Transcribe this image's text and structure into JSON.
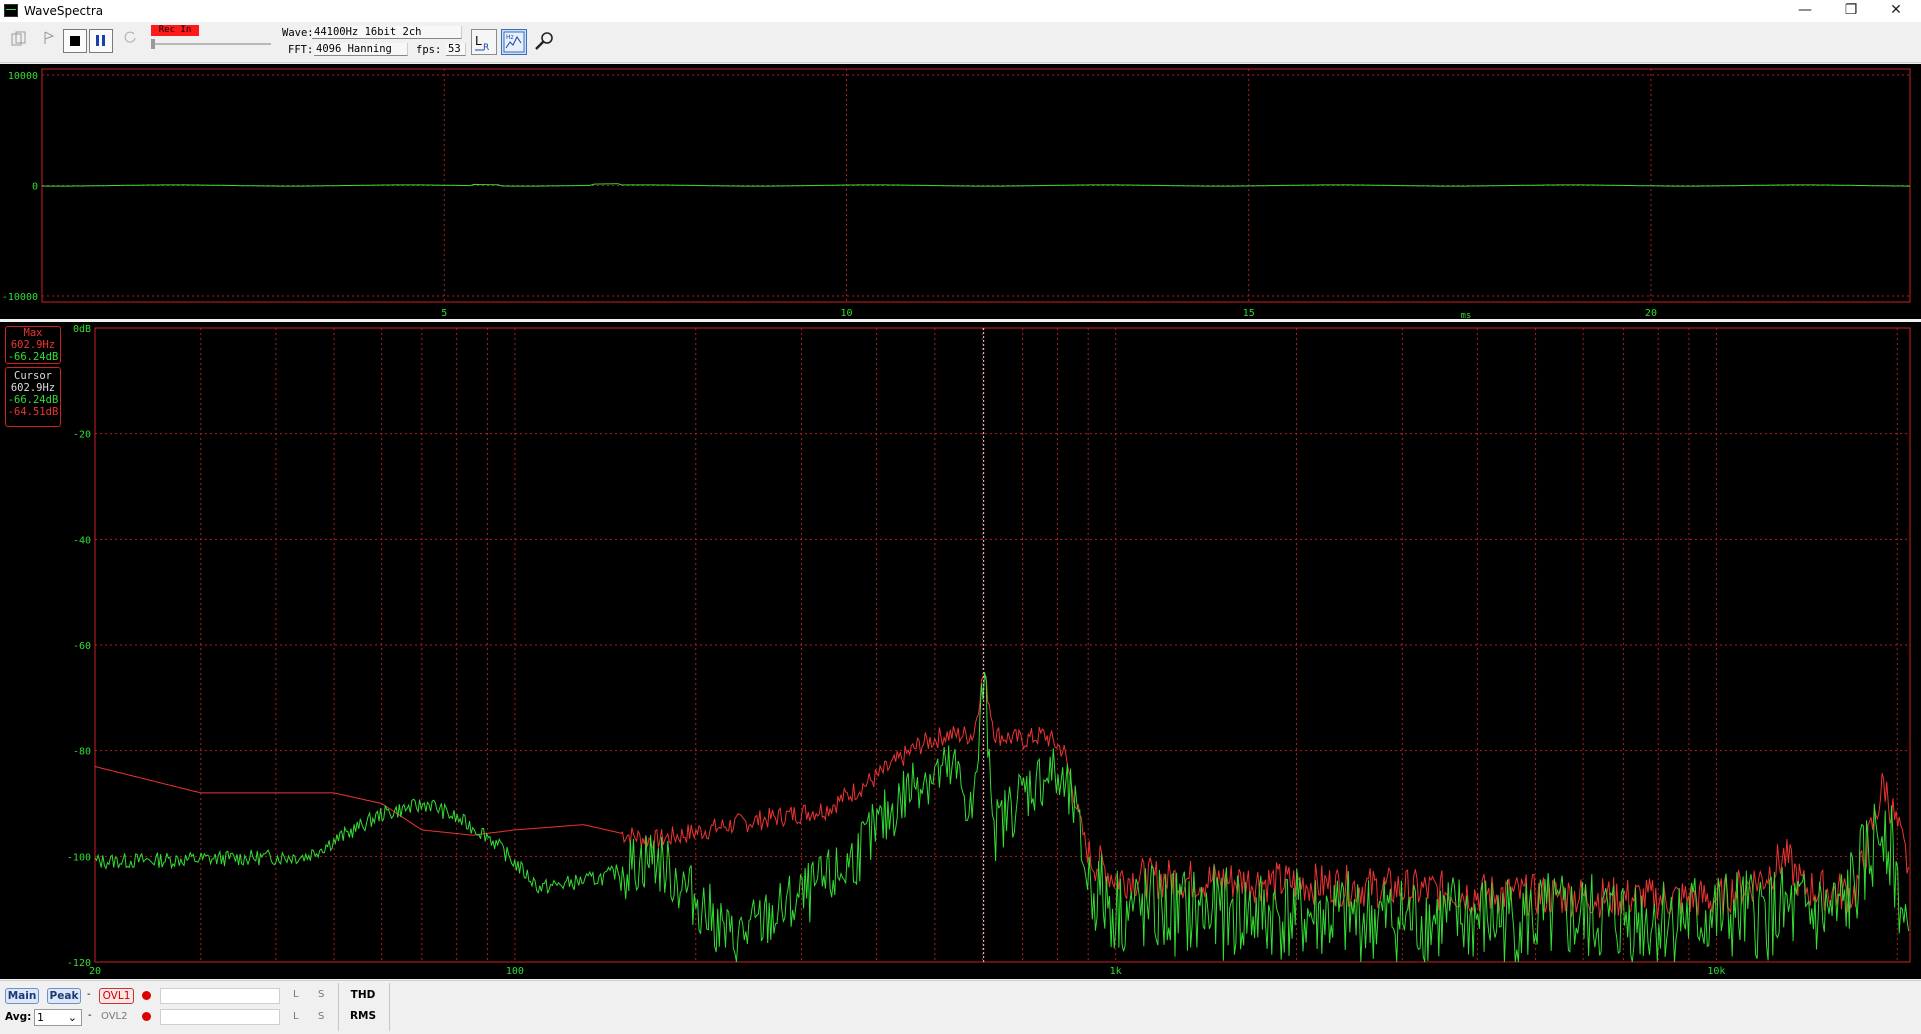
{
  "window": {
    "title": "WaveSpectra",
    "controls": {
      "minimize": "—",
      "restore": "❐",
      "close": "✕"
    }
  },
  "toolbar": {
    "rec_label": "Rec In",
    "wave_label": "Wave:",
    "wave_value": "44100Hz 16bit 2ch",
    "fft_label": "FFT:",
    "fft_value": "4096 Hanning",
    "fps_label": "fps:",
    "fps_value": "53"
  },
  "colors": {
    "plot_bg": "#000000",
    "grid": "#b02020",
    "left_channel": "#33dd33",
    "right_channel": "#ee3333",
    "frame": "#cc2222"
  },
  "wave_panel": {
    "y_labels": [
      "10000",
      "0",
      "-10000"
    ],
    "x_labels": [
      "5",
      "10",
      "15",
      "20"
    ],
    "unit": "ms"
  },
  "spectrum_panel": {
    "y_labels": [
      "0dB",
      "-20",
      "-40",
      "-60",
      "-80",
      "-100",
      "-120"
    ],
    "x_labels": [
      "20",
      "100",
      "1k",
      "10k"
    ],
    "max_box": {
      "title": "Max",
      "freq": "602.9Hz",
      "level": "-66.24dB"
    },
    "cursor_box": {
      "title": "Cursor",
      "freq": "602.9Hz",
      "level_left": "-66.24dB",
      "level_right": "-64.51dB"
    }
  },
  "bottom": {
    "main_label": "Main",
    "peak_label": "Peak",
    "dash1": "-",
    "ovl1_label": "OVL1",
    "ovl2_label": "OVL2",
    "dash2": "-",
    "avg_label": "Avg:",
    "avg_value": "1",
    "l1": "L",
    "s1": "S",
    "l2": "L",
    "s2": "S",
    "thd_label": "THD",
    "rms_label": "RMS"
  }
}
